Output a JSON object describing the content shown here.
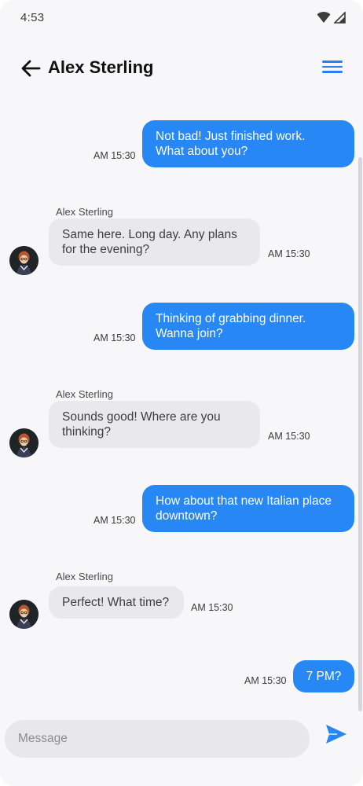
{
  "status_bar": {
    "time": "4:53",
    "icons": [
      "wifi-icon",
      "cellular-icon"
    ]
  },
  "header": {
    "title": "Alex Sterling",
    "back_icon": "arrow-left-icon",
    "menu_icon": "hamburger-menu-icon"
  },
  "colors": {
    "accent": "#2787f5",
    "incoming_bubble": "#e9e8ec",
    "background": "#f7f6f8"
  },
  "messages": [
    {
      "direction": "out",
      "lines": [
        "Not bad! Just finished work.",
        "What about you?"
      ],
      "time": "AM 15:30"
    },
    {
      "direction": "in",
      "sender": "Alex Sterling",
      "lines": [
        "Same here. Long day. Any plans",
        "for the evening?"
      ],
      "time": "AM 15:30"
    },
    {
      "direction": "out",
      "lines": [
        "Thinking of grabbing dinner.",
        "Wanna join?"
      ],
      "time": "AM 15:30"
    },
    {
      "direction": "in",
      "sender": "Alex Sterling",
      "lines": [
        "Sounds good! Where are you",
        "thinking?"
      ],
      "time": "AM 15:30"
    },
    {
      "direction": "out",
      "lines": [
        "How about that new Italian place",
        "downtown?"
      ],
      "time": "AM 15:30"
    },
    {
      "direction": "in",
      "sender": "Alex Sterling",
      "lines": [
        "Perfect! What time?"
      ],
      "time": "AM 15:30"
    },
    {
      "direction": "out",
      "lines": [
        "7 PM?"
      ],
      "time": "AM 15:30"
    }
  ],
  "composer": {
    "placeholder": "Message",
    "value": "",
    "send_icon": "send-icon"
  }
}
